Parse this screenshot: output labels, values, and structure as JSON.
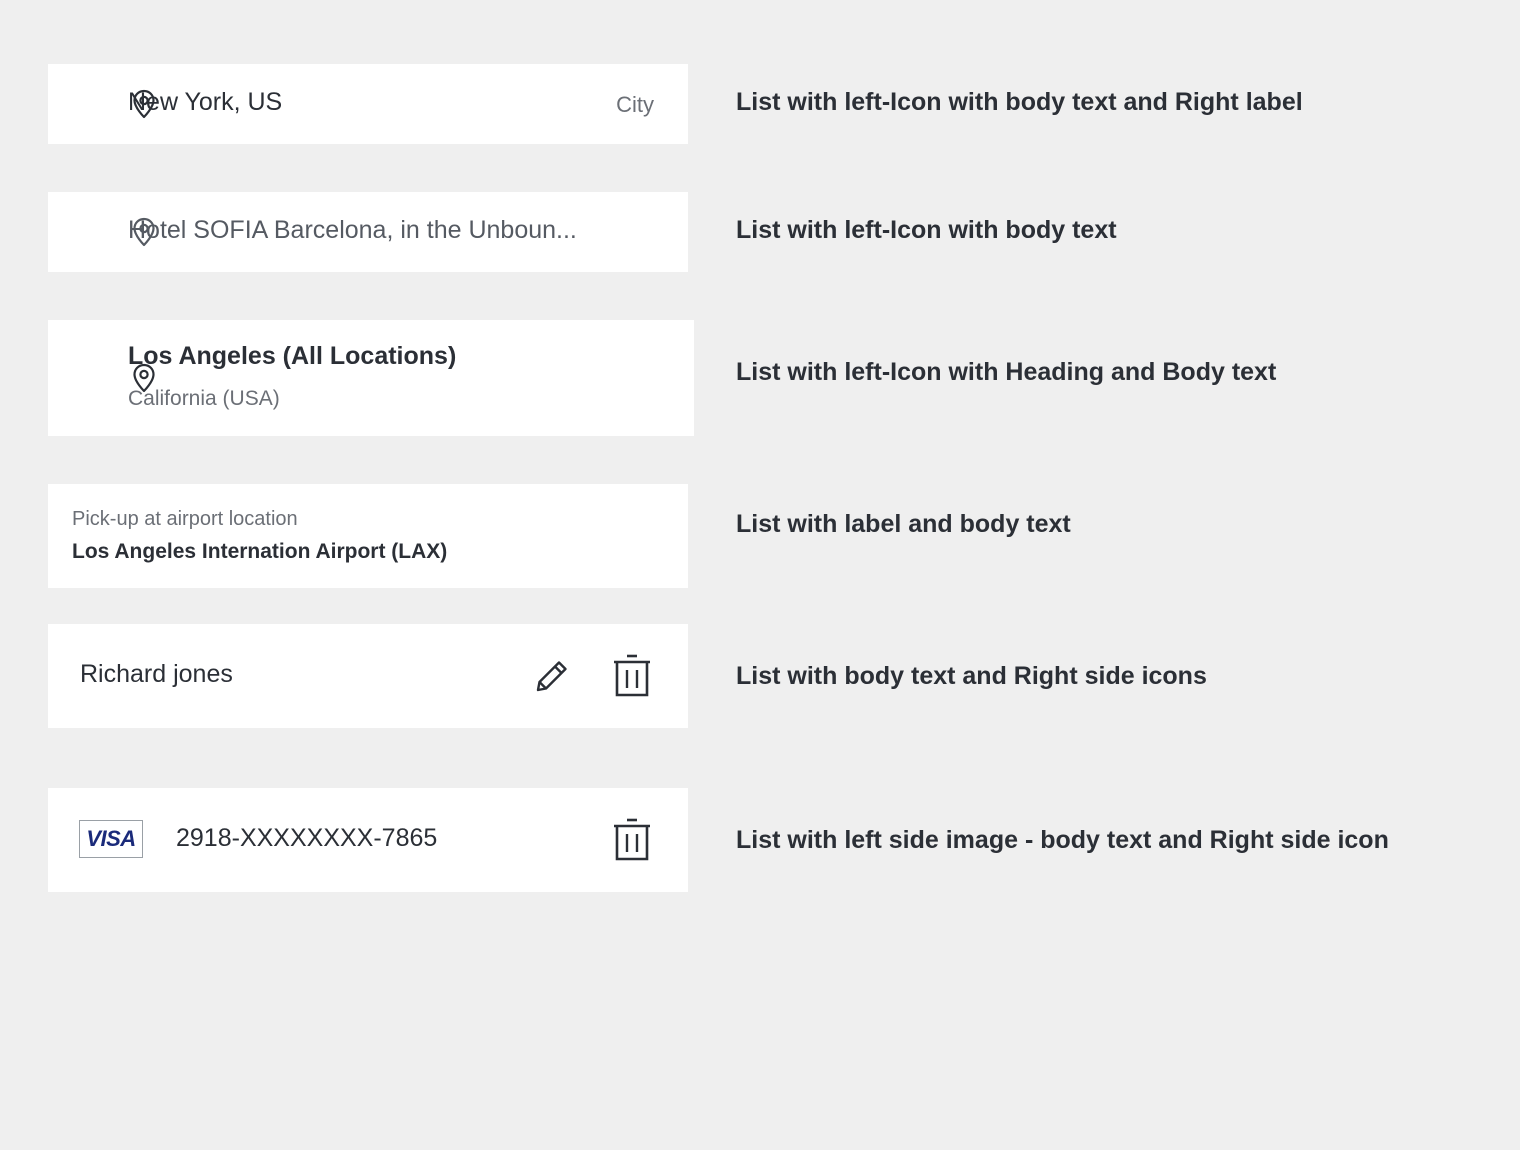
{
  "rows": [
    {
      "body": "New York, US",
      "right_label": "City",
      "description": "List with left-Icon with body text and Right label"
    },
    {
      "body": "Hotel SOFIA Barcelona, in the Unboun...",
      "description": "List with left-Icon with body text"
    },
    {
      "heading": "Los Angeles (All Locations)",
      "body": "California (USA)",
      "description": "List with left-Icon with Heading and Body text"
    },
    {
      "label": "Pick-up at airport location",
      "body": "Los Angeles Internation Airport (LAX)",
      "description": "List with label and body text"
    },
    {
      "body": "Richard jones",
      "description": "List with body text and Right side icons"
    },
    {
      "image_text": "VISA",
      "body": "2918-XXXXXXXX-7865",
      "description": "List with left side image - body text and Right side icon"
    }
  ],
  "icons": {
    "location": "map-pin-icon",
    "edit": "pencil-icon",
    "delete": "trash-icon"
  },
  "colors": {
    "background": "#efefef",
    "row": "#ffffff",
    "text": "#2b2f36",
    "muted": "#6b6f76",
    "visa": "#1a2a7a"
  }
}
